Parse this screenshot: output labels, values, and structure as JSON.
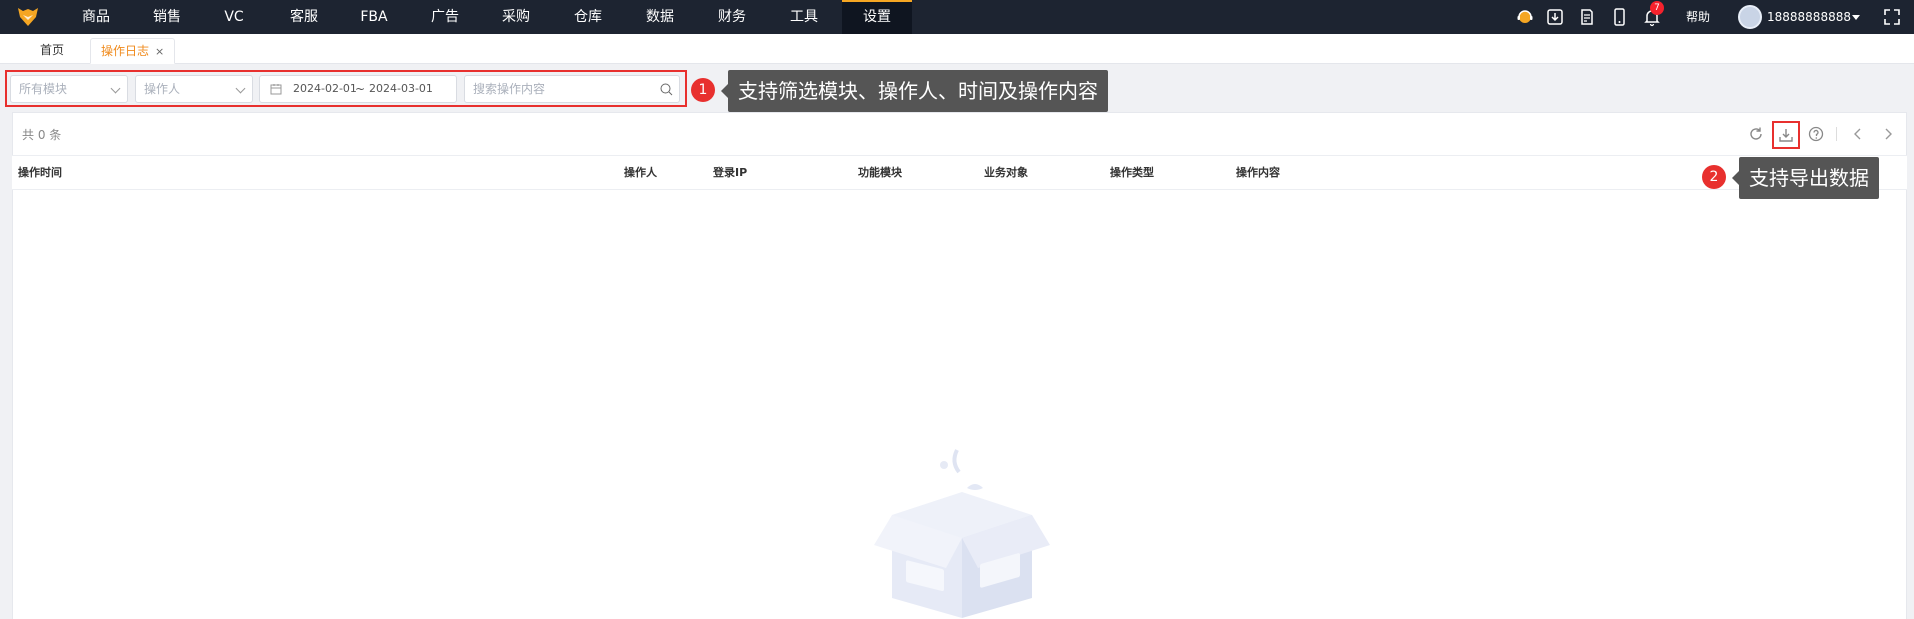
{
  "nav": {
    "items": [
      "商品",
      "销售",
      "VC",
      "客服",
      "FBA",
      "广告",
      "采购",
      "仓库",
      "数据",
      "财务",
      "工具",
      "设置"
    ],
    "active": "设置",
    "help": "帮助",
    "username": "18888888888",
    "notification_count": "7"
  },
  "tabs": {
    "home": "首页",
    "active": "操作日志",
    "close": "×"
  },
  "filters": {
    "module_placeholder": "所有模块",
    "operator_placeholder": "操作人",
    "date_start": "2024-02-01",
    "date_sep": "~",
    "date_end": "2024-03-01",
    "search_placeholder": "搜索操作内容"
  },
  "callouts": [
    {
      "num": "1",
      "text": "支持筛选模块、操作人、时间及操作内容"
    },
    {
      "num": "2",
      "text": "支持导出数据"
    }
  ],
  "table": {
    "total": "共 0 条",
    "columns": [
      "操作时间",
      "操作人",
      "登录IP",
      "功能模块",
      "业务对象",
      "操作类型",
      "操作内容"
    ],
    "rows": []
  },
  "colors": {
    "nav_bg": "#1d2431",
    "accent": "#f08b1d",
    "callout_red": "#e8302e",
    "callout_bg": "#555555"
  }
}
